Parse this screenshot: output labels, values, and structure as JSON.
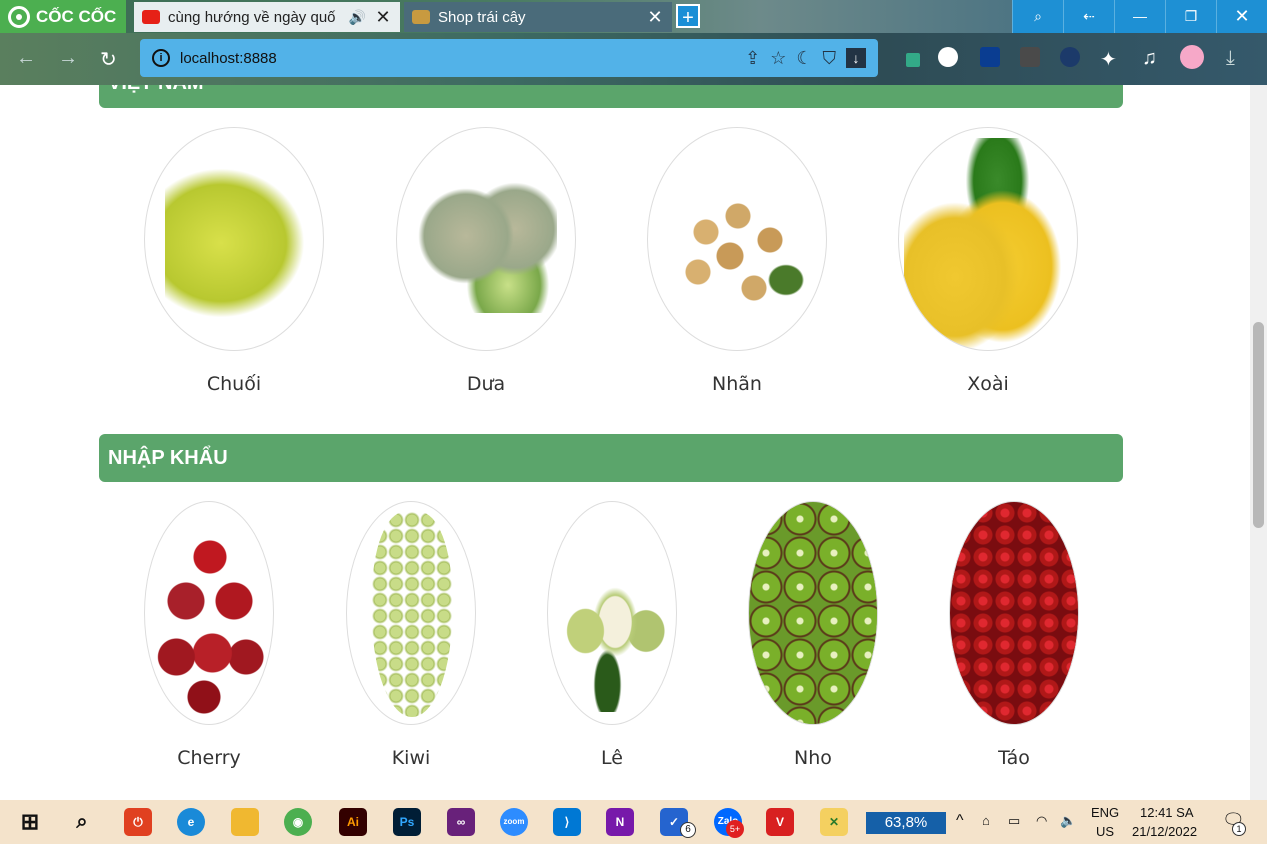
{
  "browser": {
    "brand": "CỐC CỐC",
    "tabs": [
      {
        "title": "cùng hướng về ngày quố",
        "favicon": "youtube-icon"
      },
      {
        "title": "Shop trái cây",
        "favicon": "fruit-shop-icon"
      }
    ],
    "new_tab_label": "+",
    "url": "localhost:8888",
    "window_controls": [
      "screen-search",
      "back-arrow",
      "minimize",
      "restore",
      "close"
    ]
  },
  "sections": [
    {
      "title": "VIỆT NAM",
      "fruits": [
        {
          "name": "Chuối",
          "color": "#c8d636"
        },
        {
          "name": "Dưa",
          "color": "#9aa88a"
        },
        {
          "name": "Nhãn",
          "color": "#d0a868"
        },
        {
          "name": "Xoài",
          "color": "#f0c830"
        }
      ]
    },
    {
      "title": "NHẬP KHẨU",
      "fruits": [
        {
          "name": "Cherry",
          "color": "#a8202a"
        },
        {
          "name": "Kiwi",
          "color": "#b8d070"
        },
        {
          "name": "Lê",
          "color": "#b8cc78"
        },
        {
          "name": "Nho",
          "color": "#6a9a2a"
        },
        {
          "name": "Táo",
          "color": "#b01818"
        }
      ]
    }
  ],
  "taskbar": {
    "battery_label": "63,8%",
    "lang": "ENG",
    "region": "US",
    "time": "12:41 SA",
    "date": "21/12/2022",
    "notification_count": "1",
    "badges": {
      "tasks": "6",
      "zalo": "5+"
    }
  },
  "colors": {
    "section_bar": "#5ba56b",
    "accent": "#1e90d4"
  }
}
